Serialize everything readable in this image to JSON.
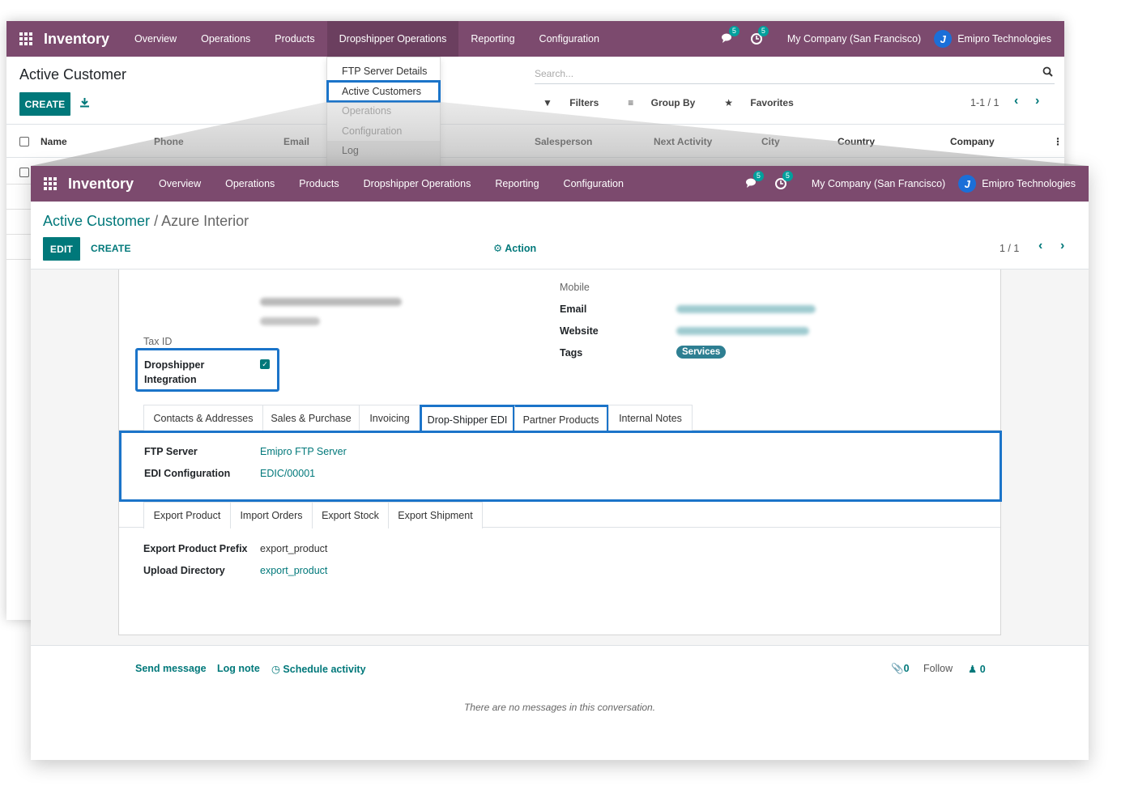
{
  "navbar": {
    "brand": "Inventory",
    "menu": [
      "Overview",
      "Operations",
      "Products",
      "Dropshipper Operations",
      "Reporting",
      "Configuration"
    ],
    "chat_badge": "5",
    "activity_badge": "5",
    "company": "My Company (San Francisco)",
    "user": "Emipro Technologies"
  },
  "dropdown": {
    "items": [
      "FTP Server Details",
      "Active Customers",
      "Operations",
      "Configuration",
      "Log"
    ]
  },
  "list_view": {
    "title": "Active Customer",
    "create_label": "CREATE",
    "search_placeholder": "Search...",
    "filters": "Filters",
    "group_by": "Group By",
    "favorites": "Favorites",
    "pager": "1-1 / 1",
    "columns": [
      "Name",
      "Phone",
      "Email",
      "Salesperson",
      "Next Activity",
      "City",
      "Country",
      "Company"
    ]
  },
  "form_view": {
    "breadcrumb_parent": "Active Customer",
    "breadcrumb_sep": "/",
    "breadcrumb_current": "Azure Interior",
    "edit_label": "EDIT",
    "create_label": "CREATE",
    "action_label": "Action",
    "pager": "1 / 1",
    "fields": {
      "mobile_label": "Mobile",
      "email_label": "Email",
      "website_label": "Website",
      "tags_label": "Tags",
      "tag_value": "Services",
      "tax_id_label": "Tax ID",
      "dropshipper_label_1": "Dropshipper",
      "dropshipper_label_2": "Integration",
      "dropshipper_checked": true
    },
    "tabs": [
      "Contacts & Addresses",
      "Sales & Purchase",
      "Invoicing",
      "Drop-Shipper EDI",
      "Partner Products",
      "Internal Notes"
    ],
    "active_tab": "Drop-Shipper EDI",
    "edi": {
      "ftp_server_label": "FTP Server",
      "ftp_server_value": "Emipro FTP Server",
      "edi_config_label": "EDI Configuration",
      "edi_config_value": "EDIC/00001"
    },
    "sub_tabs": [
      "Export Product",
      "Import Orders",
      "Export Stock",
      "Export Shipment"
    ],
    "active_sub_tab": "Export Product",
    "export": {
      "prefix_label": "Export Product Prefix",
      "prefix_value": "export_product",
      "dir_label": "Upload Directory",
      "dir_value": "export_product"
    }
  },
  "chatter": {
    "send_message": "Send message",
    "log_note": "Log note",
    "schedule_activity": "Schedule activity",
    "attachments": "0",
    "follow": "Follow",
    "followers": "0",
    "empty": "There are no messages in this conversation."
  },
  "colors": {
    "navbar": "#7c4a6e",
    "primary": "#00787a",
    "highlight": "#1b74c9"
  }
}
